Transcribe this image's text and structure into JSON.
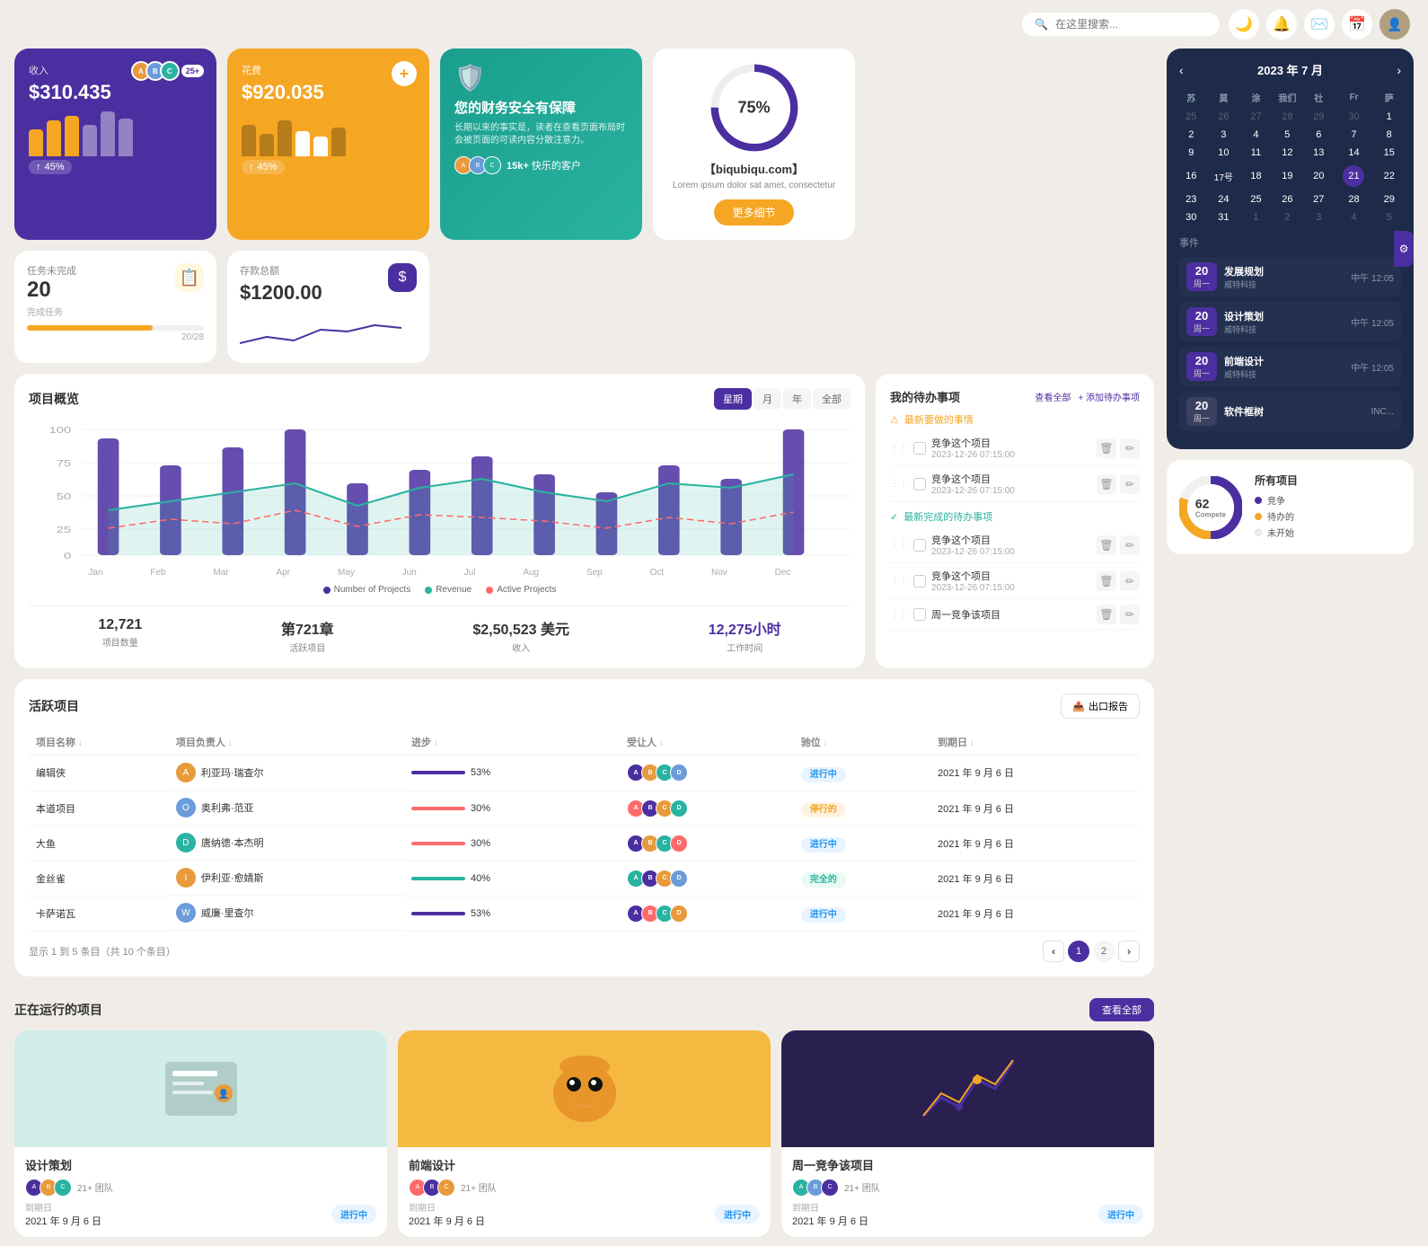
{
  "topbar": {
    "search_placeholder": "在这里搜索...",
    "avatar_initial": "👤"
  },
  "revenue_card": {
    "label": "收入",
    "amount": "$310.435",
    "badge": "25+",
    "pct": "45%",
    "bars": [
      40,
      60,
      70,
      55,
      75,
      65
    ]
  },
  "expense_card": {
    "label": "花费",
    "amount": "$920.035",
    "pct": "45%",
    "bars": [
      50,
      35,
      55,
      40,
      30,
      45
    ]
  },
  "finance_card": {
    "icon": "🛡️",
    "title": "您的财务安全有保障",
    "desc": "长期以来的事实是，读者在查看页面布局时会被页面的可读内容分散注意力。",
    "customers_count": "15k+",
    "customers_label": "快乐的客户"
  },
  "circular_card": {
    "pct": "75%",
    "domain": "【biqubiqu.com】",
    "desc": "Lorem ipsum dolor sat amet, consectetur",
    "btn_label": "更多细节"
  },
  "task_card": {
    "label": "任务未完成",
    "count": "20",
    "sub": "完成任务",
    "progress_text": "20/28",
    "progress_pct": 71
  },
  "savings_card": {
    "label": "存款总额",
    "amount": "$1200.00"
  },
  "project_overview": {
    "title": "项目概览",
    "tabs": [
      "星期",
      "月",
      "年",
      "全部"
    ],
    "active_tab": 0,
    "y_labels": [
      "100",
      "75",
      "50",
      "25",
      "0"
    ],
    "x_labels": [
      "Jan",
      "Feb",
      "Mar",
      "Apr",
      "May",
      "Jun",
      "Jul",
      "Aug",
      "Sep",
      "Oct",
      "Nov",
      "Dec"
    ],
    "stats": [
      {
        "value": "12,721",
        "label": "项目数量"
      },
      {
        "value": "第721章",
        "label": "活跃项目"
      },
      {
        "value": "$2,50,523 美元",
        "label": "收入"
      },
      {
        "value": "12,275小时",
        "label": "工作时间",
        "accent": true
      }
    ],
    "legend": [
      {
        "label": "Number of Projects",
        "color": "#4b2fa0"
      },
      {
        "label": "Revenue",
        "color": "#2ab3a0"
      },
      {
        "label": "Active Projects",
        "color": "#ff6b6b"
      }
    ]
  },
  "todo": {
    "title": "我的待办事项",
    "view_all": "查看全部",
    "add_label": "+ 添加待办事项",
    "sections": [
      {
        "type": "warning",
        "label": "最新要做的事情",
        "items": [
          {
            "text": "竞争这个项目",
            "date": "2023-12-26 07:15:00"
          },
          {
            "text": "竞争这个项目",
            "date": "2023-12-26 07:15:00"
          }
        ]
      },
      {
        "type": "success",
        "label": "最新完成的待办事项",
        "items": [
          {
            "text": "竞争这个项目",
            "date": "2023-12-26 07:15:00"
          },
          {
            "text": "竞争这个项目",
            "date": "2023-12-26 07:15:00"
          }
        ]
      }
    ]
  },
  "calendar": {
    "title": "2023 年 7 月",
    "days_header": [
      "苏",
      "莫",
      "涂",
      "我们",
      "社",
      "Fr",
      "萨"
    ],
    "weeks": [
      [
        "25",
        "26",
        "27",
        "28",
        "29",
        "30",
        "1"
      ],
      [
        "2",
        "3",
        "4",
        "5",
        "6",
        "7",
        "8"
      ],
      [
        "9",
        "10",
        "11",
        "12",
        "13",
        "14",
        "15"
      ],
      [
        "16",
        "17号",
        "18",
        "19",
        "20",
        "21",
        "22"
      ],
      [
        "23",
        "24",
        "25",
        "26",
        "27",
        "28",
        "29"
      ],
      [
        "30",
        "31",
        "1",
        "2",
        "3",
        "4",
        "5"
      ]
    ],
    "today_day": "21",
    "events_title": "事件",
    "events": [
      {
        "date_num": "20",
        "date_day": "周一",
        "name": "发展规划",
        "sub": "威特科技",
        "time": "中午 12:05"
      },
      {
        "date_num": "20",
        "date_day": "周一",
        "name": "设计策划",
        "sub": "威特科技",
        "time": "中午 12:05"
      },
      {
        "date_num": "20",
        "date_day": "周一",
        "name": "前端设计",
        "sub": "威特科技",
        "time": "中午 12:05"
      },
      {
        "date_num": "20",
        "date_day": "周一",
        "name": "软件框树",
        "sub": "",
        "time": "INC..."
      }
    ]
  },
  "active_projects": {
    "title": "活跃项目",
    "export_btn": "出口报告",
    "columns": [
      "项目名称",
      "项目负责人",
      "进步",
      "受让人",
      "驰位",
      "到期日"
    ],
    "rows": [
      {
        "name": "编辑侠",
        "manager": "利亚玛·瑞查尔",
        "progress": 53,
        "color": "#4b2fa0",
        "status": "进行中",
        "status_class": "status-inprogress",
        "due": "2021 年 9 月 6 日"
      },
      {
        "name": "本道项目",
        "manager": "奥利弗·范亚",
        "progress": 30,
        "color": "#ff6b6b",
        "status": "停行的",
        "status_class": "status-paused",
        "due": "2021 年 9 月 6 日"
      },
      {
        "name": "大鱼",
        "manager": "唐纳德·本杰明",
        "progress": 30,
        "color": "#ff6b6b",
        "status": "进行中",
        "status_class": "status-inprogress",
        "due": "2021 年 9 月 6 日"
      },
      {
        "name": "金丝雀",
        "manager": "伊利亚·愈婧斯",
        "progress": 40,
        "color": "#2ab3a0",
        "status": "完全的",
        "status_class": "status-completed",
        "due": "2021 年 9 月 6 日"
      },
      {
        "name": "卡萨诺瓦",
        "manager": "威廉·里查尔",
        "progress": 53,
        "color": "#4b2fa0",
        "status": "进行中",
        "status_class": "status-inprogress",
        "due": "2021 年 9 月 6 日"
      }
    ],
    "pagination": {
      "showing": "显示 1 到 5 条目（共 10 个条目）",
      "current_page": 1,
      "total_pages": 2
    }
  },
  "running_projects": {
    "title": "正在运行的项目",
    "view_all": "查看全部",
    "cards": [
      {
        "title": "设计策划",
        "thumb_bg": "#e8f5f3",
        "thumb_emoji": "🧑‍💼",
        "team_label": "21+ 团队",
        "due_label": "到期日",
        "due_date": "2021 年 9 月 6 日",
        "status": "进行中",
        "status_class": "status-inprogress"
      },
      {
        "title": "前端设计",
        "thumb_bg": "#fff3e0",
        "thumb_emoji": "🐱",
        "team_label": "21+ 团队",
        "due_label": "到期日",
        "due_date": "2021 年 9 月 6 日",
        "status": "进行中",
        "status_class": "status-inprogress"
      },
      {
        "title": "周一竞争该项目",
        "thumb_bg": "#2a2050",
        "thumb_emoji": "📊",
        "team_label": "21+ 团队",
        "due_label": "到期日",
        "due_date": "2021 年 9 月 6 日",
        "status": "进行中",
        "status_class": "status-inprogress"
      }
    ]
  },
  "all_projects": {
    "title": "所有项目",
    "total": "62",
    "total_sub": "Compete",
    "legend": [
      {
        "label": "竞争",
        "color": "#4b2fa0"
      },
      {
        "label": "待办的",
        "color": "#f5a623"
      },
      {
        "label": "未开始",
        "color": "#f0f0f0"
      }
    ]
  },
  "icons": {
    "search": "🔍",
    "moon": "🌙",
    "bell": "🔔",
    "mail": "✉️",
    "calendar": "📅",
    "export": "📤",
    "warning": "⚠",
    "check": "✓",
    "prev": "‹",
    "next": "›",
    "settings": "⚙",
    "delete": "🗑",
    "edit": "✏"
  }
}
